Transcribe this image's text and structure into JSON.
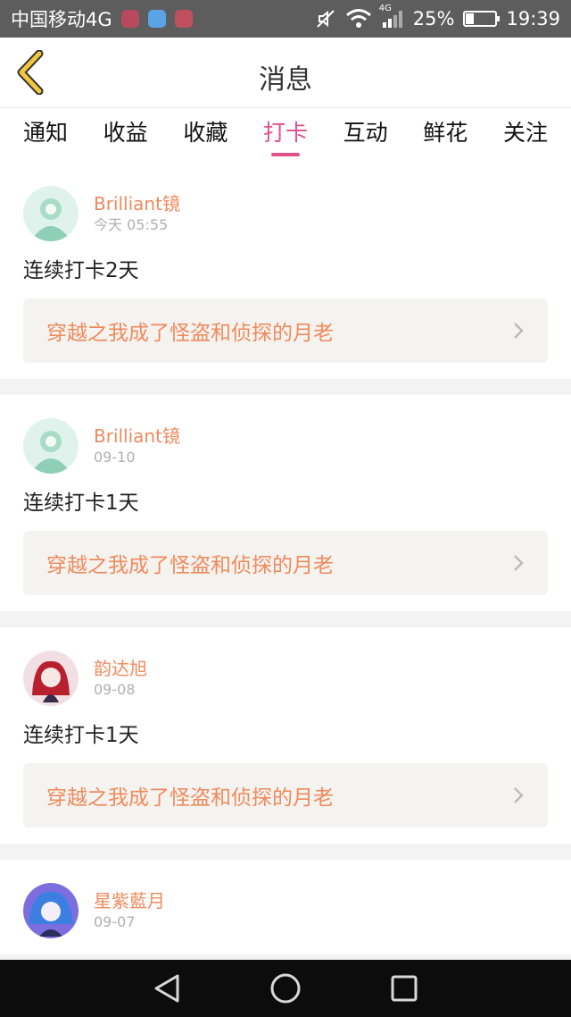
{
  "status_bar": {
    "carrier": "中国移动4G",
    "net_type": "4G",
    "battery": "25%",
    "battery_level": 0.25,
    "time": "19:39"
  },
  "header": {
    "title": "消息"
  },
  "tabs": [
    {
      "label": "通知"
    },
    {
      "label": "收益"
    },
    {
      "label": "收藏"
    },
    {
      "label": "打卡",
      "active": true
    },
    {
      "label": "互动"
    },
    {
      "label": "鲜花"
    },
    {
      "label": "关注"
    }
  ],
  "feed": [
    {
      "user": "Brilliant镜",
      "time": "今天 05:55",
      "text": "连续打卡2天",
      "book": "穿越之我成了怪盗和侦探的月老",
      "avatar": "mint-avatar"
    },
    {
      "user": "Brilliant镜",
      "time": "09-10",
      "text": "连续打卡1天",
      "book": "穿越之我成了怪盗和侦探的月老",
      "avatar": "mint-avatar"
    },
    {
      "user": "韵达旭",
      "time": "09-08",
      "text": "连续打卡1天",
      "book": "穿越之我成了怪盗和侦探的月老",
      "avatar": "red-avatar"
    },
    {
      "user": "星紫藍月",
      "time": "09-07",
      "avatar": "blue-avatar"
    }
  ],
  "colors": {
    "accent": "#e0508a",
    "username": "#f08a5d",
    "book_bg": "#f4f3ef",
    "back_arrow": "#f3c63b"
  }
}
